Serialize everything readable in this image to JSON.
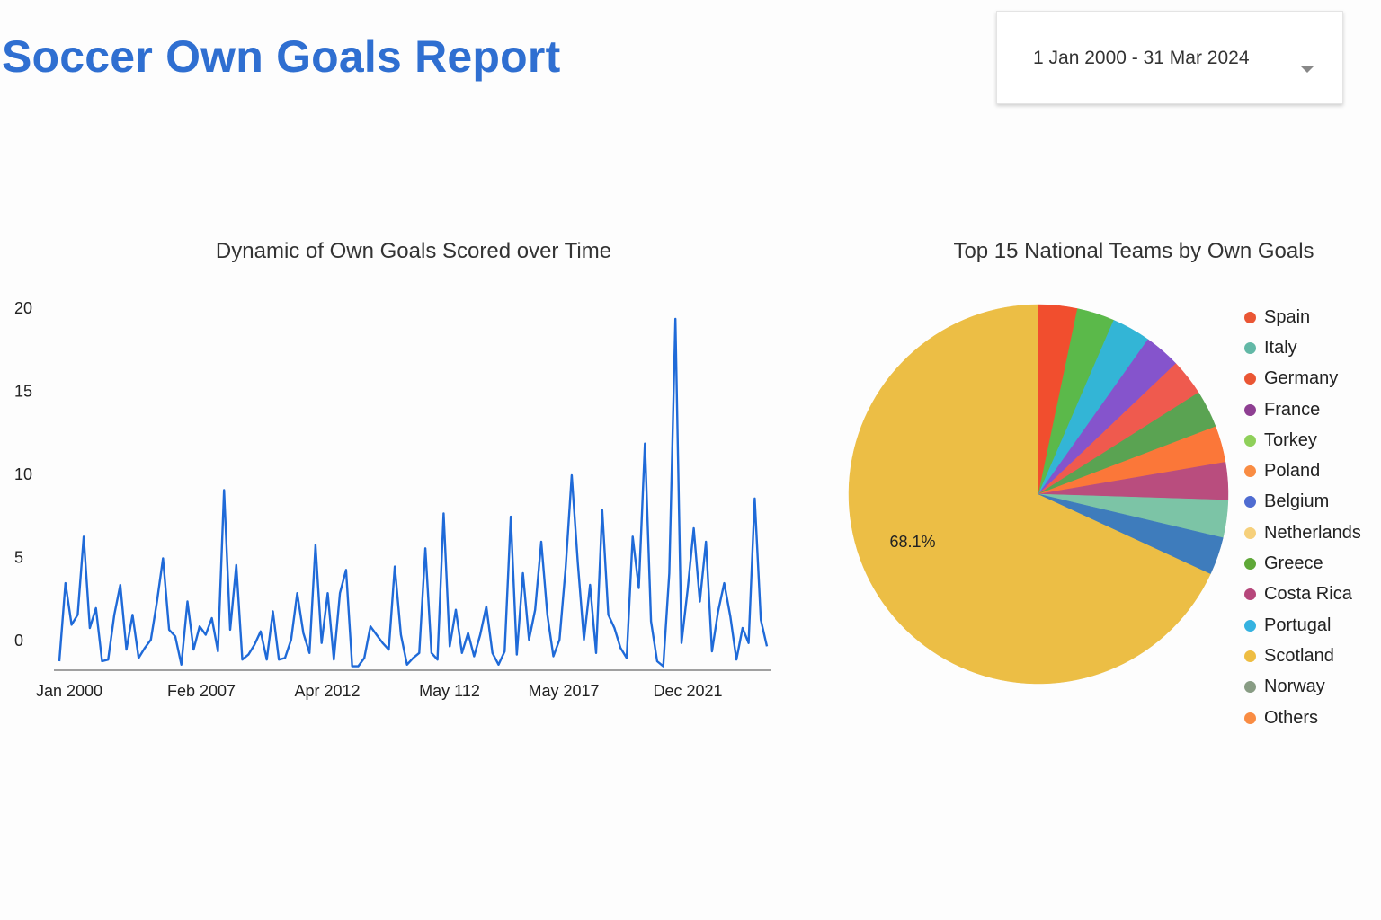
{
  "header": {
    "title": "Soccer Own Goals Report",
    "date_range": "1 Jan 2000 - 31 Mar 2024"
  },
  "icons": {
    "date_dropdown": "chevron-down-icon"
  },
  "chart_data": [
    {
      "type": "line",
      "title": "Dynamic of Own Goals Scored over Time",
      "xlabel": "",
      "ylabel": "",
      "ylim": [
        -1.5,
        20
      ],
      "yticks": [
        0,
        5,
        10,
        15,
        20
      ],
      "xtick_labels": [
        "Jan 2000",
        "Feb 2007",
        "Apr 2012",
        "May 112",
        "May 2017",
        "Dec 2021"
      ],
      "color": "#1f6ad8",
      "series": [
        {
          "values": [
            -1.3,
            3.4,
            0.9,
            1.5,
            6.2,
            0.7,
            1.9,
            -1.3,
            -1.2,
            1.5,
            3.3,
            -0.6,
            1.5,
            -1.1,
            -0.5,
            0.0,
            2.3,
            4.9,
            0.6,
            0.2,
            -1.5,
            2.3,
            -0.6,
            0.8,
            0.3,
            1.3,
            -0.7,
            9.0,
            0.6,
            4.5,
            -1.2,
            -0.9,
            -0.3,
            0.5,
            -1.2,
            1.7,
            -1.2,
            -1.1,
            0.0,
            2.8,
            0.4,
            -0.8,
            5.7,
            -0.2,
            2.8,
            -1.2,
            2.8,
            4.2,
            -1.6,
            -1.6,
            -1.1,
            0.8,
            0.3,
            -0.2,
            -0.6,
            4.4,
            0.3,
            -1.5,
            -1.1,
            -0.8,
            5.5,
            -0.8,
            -1.2,
            7.6,
            -0.4,
            1.8,
            -0.8,
            0.4,
            -1.0,
            0.3,
            2.0,
            -0.8,
            -1.5,
            -0.7,
            7.4,
            -0.9,
            4.0,
            0.0,
            1.8,
            5.9,
            1.5,
            -1.0,
            0.0,
            4.3,
            9.9,
            4.6,
            0.0,
            3.3,
            -0.8,
            7.8,
            1.5,
            0.7,
            -0.5,
            -1.1,
            6.2,
            3.1,
            11.8,
            1.1,
            -1.3,
            -1.6,
            4.0,
            19.3,
            -0.2,
            3.0,
            6.7,
            2.3,
            5.9,
            -0.7,
            1.7,
            3.4,
            1.4,
            -1.2,
            0.7,
            -0.2,
            8.5,
            1.2,
            -0.4
          ]
        }
      ]
    },
    {
      "type": "pie",
      "title": "Top 15 National Teams by Own Goals",
      "legend_position": "right",
      "slice_label": "68.1%",
      "categories": [
        "Spain",
        "Italy",
        "Germany",
        "France",
        "Torkey",
        "Poland",
        "Belgium",
        "Netherlands",
        "Greece",
        "Costa Rica",
        "Portugal",
        "Scotland",
        "Norway",
        "Others"
      ],
      "legend_colors": [
        "#ea5634",
        "#62b8a6",
        "#ea5634",
        "#8e3f92",
        "#8fd05a",
        "#f98c43",
        "#4f6cd1",
        "#f6d07b",
        "#5fa838",
        "#b6477b",
        "#35b2e0",
        "#eebd42",
        "#889c84",
        "#f98c43"
      ],
      "slices": [
        {
          "value": 68.1,
          "color": "#ecbe45"
        },
        {
          "value": 3.3,
          "color": "#f14e2e"
        },
        {
          "value": 3.2,
          "color": "#5bb94a"
        },
        {
          "value": 3.3,
          "color": "#33b5d6"
        },
        {
          "value": 3.1,
          "color": "#8554cc"
        },
        {
          "value": 3.1,
          "color": "#ef5a4e"
        },
        {
          "value": 3.2,
          "color": "#5aa352"
        },
        {
          "value": 3.1,
          "color": "#fb7739"
        },
        {
          "value": 3.2,
          "color": "#b94d7e"
        },
        {
          "value": 3.2,
          "color": "#7cc4a6"
        },
        {
          "value": 3.2,
          "color": "#3e7cbc"
        }
      ]
    }
  ]
}
